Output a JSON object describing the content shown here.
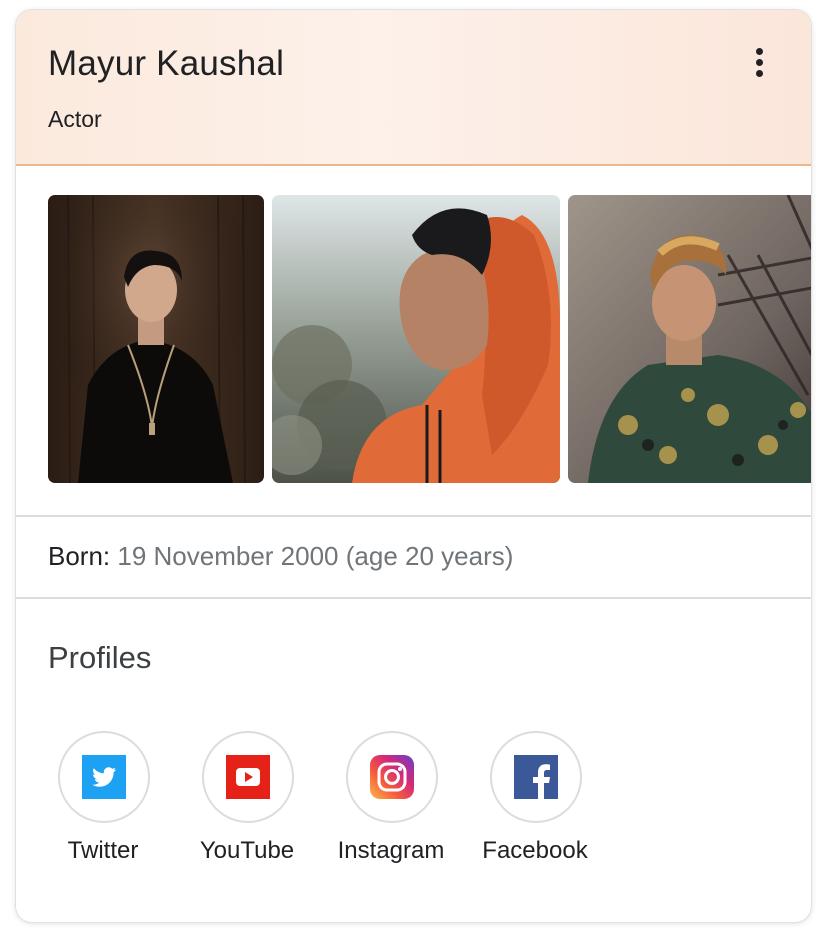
{
  "card": {
    "title": "Mayur Kaushal",
    "subtitle": "Actor",
    "more_icon": "more-vert-icon"
  },
  "photos": [
    {
      "name": "photo-1",
      "description_icon": "portrait-photo"
    },
    {
      "name": "photo-2",
      "description_icon": "portrait-photo"
    },
    {
      "name": "photo-3",
      "description_icon": "portrait-photo"
    }
  ],
  "facts": {
    "born_label": "Born:",
    "born_value": " 19 November 2000 (age 20 years)"
  },
  "profiles": {
    "heading": "Profiles",
    "items": [
      {
        "label": "Twitter",
        "icon": "twitter-icon",
        "color": "#1da1f2"
      },
      {
        "label": "YouTube",
        "icon": "youtube-icon",
        "color": "#e62117"
      },
      {
        "label": "Instagram",
        "icon": "instagram-icon",
        "color": "#c13584"
      },
      {
        "label": "Facebook",
        "icon": "facebook-icon",
        "color": "#3b5998"
      }
    ]
  },
  "colors": {
    "header_bg": "#fbe9dc",
    "header_border": "#e8b98f",
    "muted_text": "#70757a"
  }
}
